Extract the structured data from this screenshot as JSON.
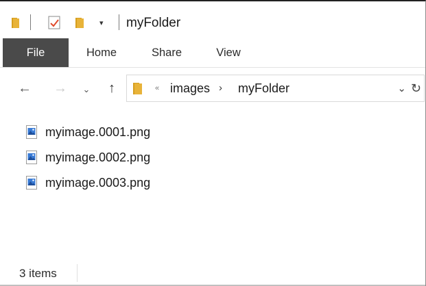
{
  "titlebar": {
    "title": "myFolder",
    "dropdown_glyph": "▾"
  },
  "ribbon": {
    "tabs": [
      {
        "label": "File",
        "active": true
      },
      {
        "label": "Home"
      },
      {
        "label": "Share"
      },
      {
        "label": "View"
      }
    ]
  },
  "nav": {
    "back_glyph": "←",
    "forward_glyph": "→",
    "recent_glyph": "⌄",
    "up_glyph": "↑"
  },
  "address": {
    "overflow_glyph": "«",
    "crumbs": [
      "images",
      "myFolder"
    ],
    "separator_glyph": "›",
    "dropdown_glyph": "⌄",
    "refresh_glyph": "↻"
  },
  "files": [
    {
      "name": "myimage.0001.png",
      "icon": "png-image-icon"
    },
    {
      "name": "myimage.0002.png",
      "icon": "png-image-icon"
    },
    {
      "name": "myimage.0003.png",
      "icon": "png-image-icon"
    }
  ],
  "status": {
    "item_count": "3 items"
  },
  "colors": {
    "folder": "#e8b339",
    "folder_dark": "#d69e1f",
    "file_tab_bg": "#4a4a4a",
    "image_icon_blue": "#3a7bd5"
  }
}
